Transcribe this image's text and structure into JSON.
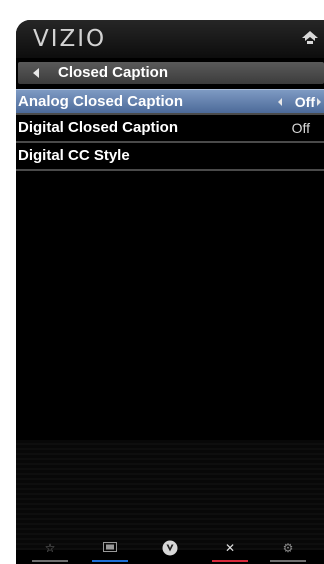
{
  "header": {
    "logo_text": "VIZIO",
    "home_icon": "home-icon"
  },
  "menu": {
    "title": "Closed Caption",
    "items": [
      {
        "label": "Analog Closed Caption",
        "value": "Off",
        "selected": true
      },
      {
        "label": "Digital Closed Caption",
        "value": "Off",
        "selected": false
      },
      {
        "label": "Digital CC Style",
        "value": "",
        "selected": false
      }
    ]
  },
  "footer": {
    "buttons": [
      {
        "icon": "star-icon",
        "color": "#6f6f6f"
      },
      {
        "icon": "widescreen-icon",
        "color": "#1f6fd6"
      },
      {
        "icon": "vizio-v-icon",
        "color": ""
      },
      {
        "icon": "close-icon",
        "color": "#d8283a"
      },
      {
        "icon": "gear-icon",
        "color": "#6f6f6f"
      }
    ]
  },
  "colors": {
    "selection_top": "#7e9ac3",
    "selection_bottom": "#4c6a99",
    "background": "#000000"
  }
}
